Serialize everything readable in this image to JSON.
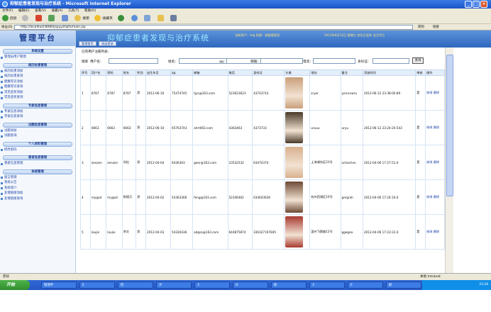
{
  "window": {
    "title": "抑郁症患者发现与治疗系统 - Microsoft Internet Explorer"
  },
  "menu": [
    "文件(F)",
    "编辑(E)",
    "查看(V)",
    "收藏(A)",
    "工具(T)",
    "帮助(H)"
  ],
  "toolbar": {
    "back": "后退",
    "search": "搜索",
    "favorites": "收藏夹"
  },
  "address": {
    "label": "地址(D)",
    "url": "http://localhost:8080/jspyyzhzjfx/main.jsp",
    "go": "转到",
    "links": "链接"
  },
  "app": {
    "logo": "管理平台",
    "title": "抑郁症患者发现与治疗系统",
    "header_info": "当前用户：hsg 权限：超级管理员",
    "header_date": "2012年6月12日 星期三 农历壬辰年 五月廿三",
    "btn_home": "管理首页",
    "btn_logout": "退出登录"
  },
  "sidebar": [
    {
      "title": "系统设置",
      "items": [
        "管理员用户管理"
      ]
    },
    {
      "title": "病历标患管理",
      "items": [
        "病历标患添加",
        "病历标患查询",
        "健康常识添加",
        "健康常识查询",
        "常见症状添加",
        "常见症状查询"
      ]
    },
    {
      "title": "专家信息管理",
      "items": [
        "专家信息添加",
        "专家信息查询"
      ]
    },
    {
      "title": "试题信息管理",
      "items": [
        "试题添加",
        "试题查询"
      ]
    },
    {
      "title": "个人资料管理",
      "items": [
        "修改密码"
      ]
    },
    {
      "title": "患者信息管理",
      "items": [
        "患者信息管理"
      ]
    },
    {
      "title": "系统管理",
      "items": [
        "留言管理",
        "系统公告",
        "系统简介",
        "友情链接添加",
        "友情链接查询"
      ]
    }
  ],
  "main": {
    "breadcrumb": "已有用户注册列表：",
    "search": {
      "label": "搜索",
      "fields": [
        "用户名：",
        "姓名：",
        "qq：",
        "邮箱：",
        "电话：",
        "身份证："
      ],
      "button": "查询"
    },
    "columns": [
      "序号",
      "用户名",
      "密码",
      "姓名",
      "性别",
      "出生年月",
      "qq",
      "邮箱",
      "电话",
      "身份证",
      "头像",
      "地址",
      "备注",
      "添加时间",
      "审核",
      "操作"
    ],
    "rows": [
      [
        "1",
        "8787",
        "8787",
        "8787",
        "男",
        "2012-06-10",
        "75474745",
        "tjys@163.com",
        "523623623",
        "43743743",
        "",
        "sryer",
        "yeruruwru",
        "2012-06-12 23:38:00.89",
        "是",
        "修改 删除"
      ],
      [
        "2",
        "6663",
        "6663",
        "6663",
        "男",
        "2012-06-10",
        "65763743",
        "ahrt063.com",
        "4363463",
        "4373733",
        "",
        "uruuu",
        "uryu",
        "2012-06-12 23:24:20.543",
        "是",
        "修改 删除"
      ],
      [
        "3",
        "zenzen",
        "zenzen",
        "风红",
        "男",
        "2012-04-04",
        "6436363",
        "geor@163.com",
        "23532532",
        "63474374",
        "",
        "上海浦东区23号",
        "ochachxn",
        "2012-04-06 17:27:51.0",
        "是",
        "修改 删除"
      ],
      [
        "4",
        "mygod",
        "mygod",
        "陈德万",
        "男",
        "2012-04-02",
        "54363366",
        "feng@163.com",
        "52346462",
        "634643636",
        "",
        "杭州西湖区10号",
        "gergreh",
        "2012-04-06 17:24:16.0",
        "是",
        "修改 删除"
      ],
      [
        "5",
        "loujie",
        "loujie",
        "李文",
        "男",
        "2012-04-03",
        "54326436",
        "adgsa@163.com",
        "644875874",
        "330327197845",
        "",
        "温州飞鹅路12号",
        "ggegea",
        "2012-04-06 17:23:31.0",
        "是",
        "修改 删除"
      ]
    ]
  },
  "status": {
    "left": "完毕",
    "zone": "本地 Intranet"
  },
  "taskbar": {
    "start": "开始",
    "tasks": [
      "管理平",
      "E",
      "控",
      "计",
      "3",
      "D",
      "抑",
      "3",
      "E",
      "抑"
    ],
    "time": "23:28"
  },
  "colors": {
    "header": "#2f67bf",
    "title_text": "#9be7ff",
    "taskbar": "#2458c6"
  }
}
